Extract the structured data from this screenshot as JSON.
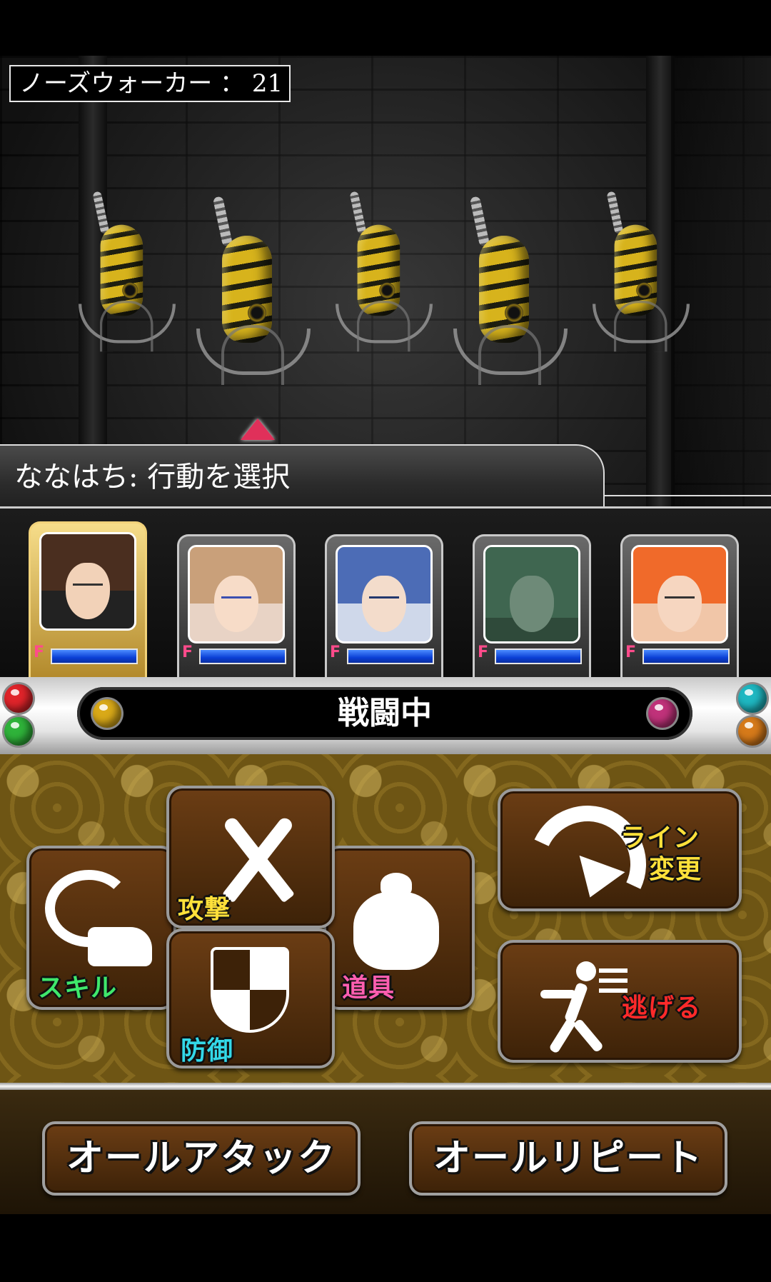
{
  "enemy_counter": {
    "label": "ノーズウォーカー ： 21"
  },
  "enemies": [
    "enemy-1",
    "enemy-2",
    "enemy-3",
    "enemy-4",
    "enemy-5"
  ],
  "message": {
    "text": "ななはち: 行動を選択"
  },
  "party": {
    "members": [
      {
        "badge": "F",
        "active": true,
        "hair": "#4a2e1f",
        "skin": "#f2d2b8"
      },
      {
        "badge": "F",
        "active": false,
        "hair": "#c9a07a",
        "skin": "#f7dcc8"
      },
      {
        "badge": "F",
        "active": false,
        "hair": "#4c6cb6",
        "skin": "#f3dccb"
      },
      {
        "badge": "F",
        "active": false,
        "hair": "#3f6650",
        "skin": "#6e8a78"
      },
      {
        "badge": "F",
        "active": false,
        "hair": "#f06a2a",
        "skin": "#f6d6c0"
      }
    ]
  },
  "status": {
    "text": "戦闘中"
  },
  "gems": {
    "red": "#e0242a",
    "green": "#2fb33a",
    "gold": "#d9a918",
    "magenta": "#c0327a",
    "teal": "#1fb8c2",
    "orange": "#d67a1a"
  },
  "commands": {
    "attack": {
      "label": "攻撃",
      "icon": "swords-icon"
    },
    "skill": {
      "label": "スキル",
      "icon": "skill-icon"
    },
    "item": {
      "label": "道具",
      "icon": "bag-icon"
    },
    "defend": {
      "label": "防御",
      "icon": "shield-icon"
    },
    "line_change": {
      "label_line1": "ライン",
      "label_line2": "変更",
      "icon": "arrow-icon"
    },
    "escape": {
      "label": "逃げる",
      "icon": "runner-icon"
    }
  },
  "bottom": {
    "all_attack": "オールアタック",
    "all_repeat": "オールリピート"
  }
}
